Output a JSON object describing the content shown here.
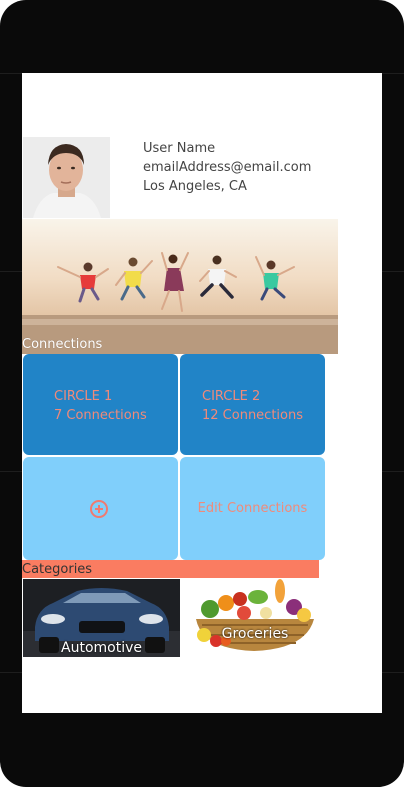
{
  "profile": {
    "name": "User Name",
    "email": "emailAddress@email.com",
    "location": "Los Angeles, CA"
  },
  "connections": {
    "label": "Connections",
    "circles": [
      {
        "name": "CIRCLE 1",
        "count": "7 Connections"
      },
      {
        "name": "CIRCLE 2",
        "count": "12 Connections"
      }
    ],
    "edit_label": "Edit Connections"
  },
  "categories": {
    "label": "Categories",
    "items": [
      {
        "label": "Automotive"
      },
      {
        "label": "Groceries"
      }
    ]
  },
  "colors": {
    "circle_tile": "#2184c7",
    "action_tile": "#80cffb",
    "accent_text": "#f08a7a",
    "categories_bar": "#fa7c61"
  },
  "icons": [
    "add-circle-icon"
  ]
}
